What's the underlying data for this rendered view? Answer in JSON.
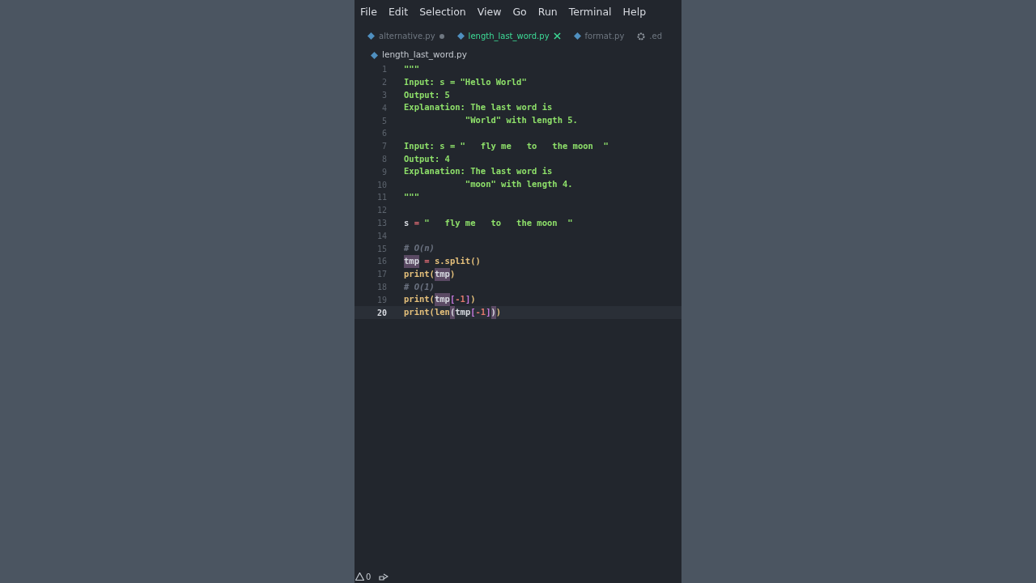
{
  "menu": [
    "File",
    "Edit",
    "Selection",
    "View",
    "Go",
    "Run",
    "Terminal",
    "Help"
  ],
  "tabs": [
    {
      "label": "alternative.py",
      "kind": "python",
      "selected": false,
      "modified": true
    },
    {
      "label": "length_last_word.py",
      "kind": "python",
      "selected": true,
      "modified": false
    },
    {
      "label": "format.py",
      "kind": "python",
      "selected": false,
      "modified": false
    },
    {
      "label": ".ed",
      "kind": "settings",
      "selected": false,
      "modified": false
    }
  ],
  "breadcrumb": "length_last_word.py",
  "lines": [
    {
      "number": "1",
      "current": false,
      "tokens": [
        {
          "text": "\"\"\"",
          "kind": "string"
        }
      ]
    },
    {
      "number": "2",
      "current": false,
      "tokens": [
        {
          "text": "Input: s = \"Hello World\"",
          "kind": "string"
        }
      ]
    },
    {
      "number": "3",
      "current": false,
      "tokens": [
        {
          "text": "Output: 5",
          "kind": "string"
        }
      ]
    },
    {
      "number": "4",
      "current": false,
      "tokens": [
        {
          "text": "Explanation: The last word is",
          "kind": "string"
        }
      ]
    },
    {
      "number": "5",
      "current": false,
      "tokens": [
        {
          "text": "            \"World\" with length 5.",
          "kind": "string"
        }
      ]
    },
    {
      "number": "6",
      "current": false
    },
    {
      "number": "7",
      "current": false,
      "tokens": [
        {
          "text": "Input: s = \"   fly me   to   the moon  \"",
          "kind": "string"
        }
      ]
    },
    {
      "number": "8",
      "current": false,
      "tokens": [
        {
          "text": "Output: 4",
          "kind": "string"
        }
      ]
    },
    {
      "number": "9",
      "current": false,
      "tokens": [
        {
          "text": "Explanation: The last word is",
          "kind": "string"
        }
      ]
    },
    {
      "number": "10",
      "current": false,
      "tokens": [
        {
          "text": "            \"moon\" with length 4.",
          "kind": "string"
        }
      ]
    },
    {
      "number": "11",
      "current": false,
      "tokens": [
        {
          "text": "\"\"\"",
          "kind": "string"
        }
      ]
    },
    {
      "number": "12",
      "current": false
    },
    {
      "number": "13",
      "current": false,
      "tokens": [
        {
          "text": "s",
          "kind": "plain"
        },
        {
          "text": " = ",
          "kind": "operator"
        },
        {
          "text": "\"   fly me   to   the moon  \"",
          "kind": "string"
        }
      ]
    },
    {
      "number": "14",
      "current": false
    },
    {
      "number": "15",
      "current": false,
      "tokens": [
        {
          "text": "# O(n)",
          "kind": "comment"
        }
      ]
    },
    {
      "number": "16",
      "current": false,
      "tokens": [
        {
          "text": "tmp",
          "kind": "highlight"
        },
        {
          "text": " = ",
          "kind": "operator"
        },
        {
          "text": "s.split()",
          "kind": "function"
        }
      ]
    },
    {
      "number": "17",
      "current": false,
      "tokens": [
        {
          "text": "print(",
          "kind": "function"
        },
        {
          "text": "tmp",
          "kind": "highlight"
        },
        {
          "text": ")",
          "kind": "function"
        }
      ]
    },
    {
      "number": "18",
      "current": false,
      "tokens": [
        {
          "text": "# O(1)",
          "kind": "comment"
        }
      ]
    },
    {
      "number": "19",
      "current": false,
      "tokens": [
        {
          "text": "print(",
          "kind": "function"
        },
        {
          "text": "tmp",
          "kind": "highlight"
        },
        {
          "text": "[",
          "kind": "bracket"
        },
        {
          "text": "-1",
          "kind": "number"
        },
        {
          "text": "]",
          "kind": "bracket"
        },
        {
          "text": ")",
          "kind": "function"
        }
      ]
    },
    {
      "number": "20",
      "current": true,
      "tokens": [
        {
          "text": "print(len",
          "kind": "function"
        },
        {
          "text": "(",
          "kind": "highlight"
        },
        {
          "text": "tmp",
          "kind": "plain"
        },
        {
          "text": "[",
          "kind": "bracket"
        },
        {
          "text": "-1",
          "kind": "number"
        },
        {
          "text": "]",
          "kind": "bracket"
        },
        {
          "text": ")",
          "kind": "highlight"
        },
        {
          "text": ")",
          "kind": "function"
        }
      ]
    }
  ],
  "status_bar": {
    "warnings": "0"
  }
}
